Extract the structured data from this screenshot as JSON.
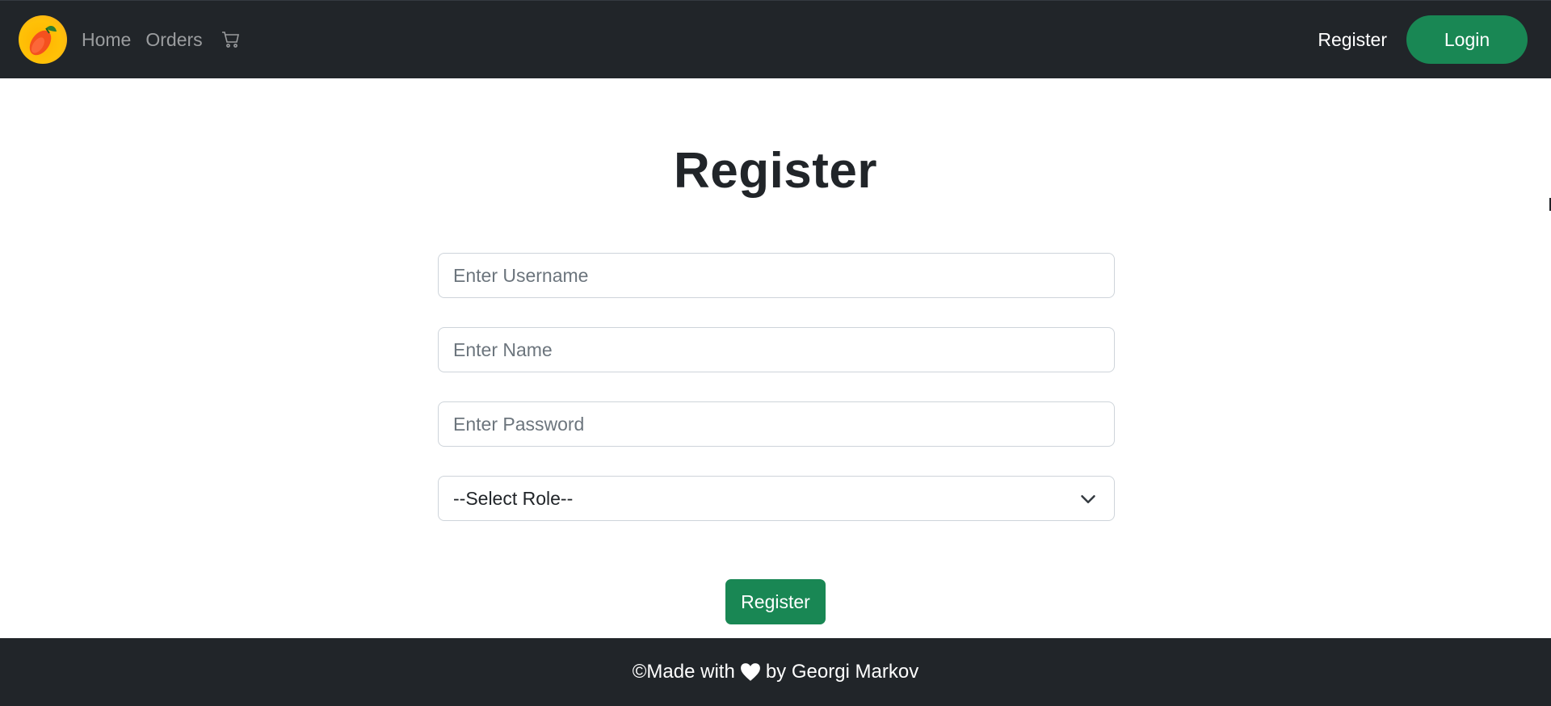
{
  "navbar": {
    "logo_icon": "mango-logo-icon",
    "links": [
      {
        "label": "Home"
      },
      {
        "label": "Orders"
      }
    ],
    "cart_icon": "cart-icon",
    "register_label": "Register",
    "login_label": "Login"
  },
  "page": {
    "title": "Register"
  },
  "form": {
    "username_placeholder": "Enter Username",
    "name_placeholder": "Enter Name",
    "password_placeholder": "Enter Password",
    "role_selected": "--Select Role--",
    "submit_label": "Register"
  },
  "footer": {
    "prefix": "©Made with",
    "heart_icon": "heart-icon",
    "suffix": "by Georgi Markov"
  },
  "colors": {
    "navbar_bg": "#212529",
    "success": "#198754",
    "logo_bg": "#ffc107"
  }
}
